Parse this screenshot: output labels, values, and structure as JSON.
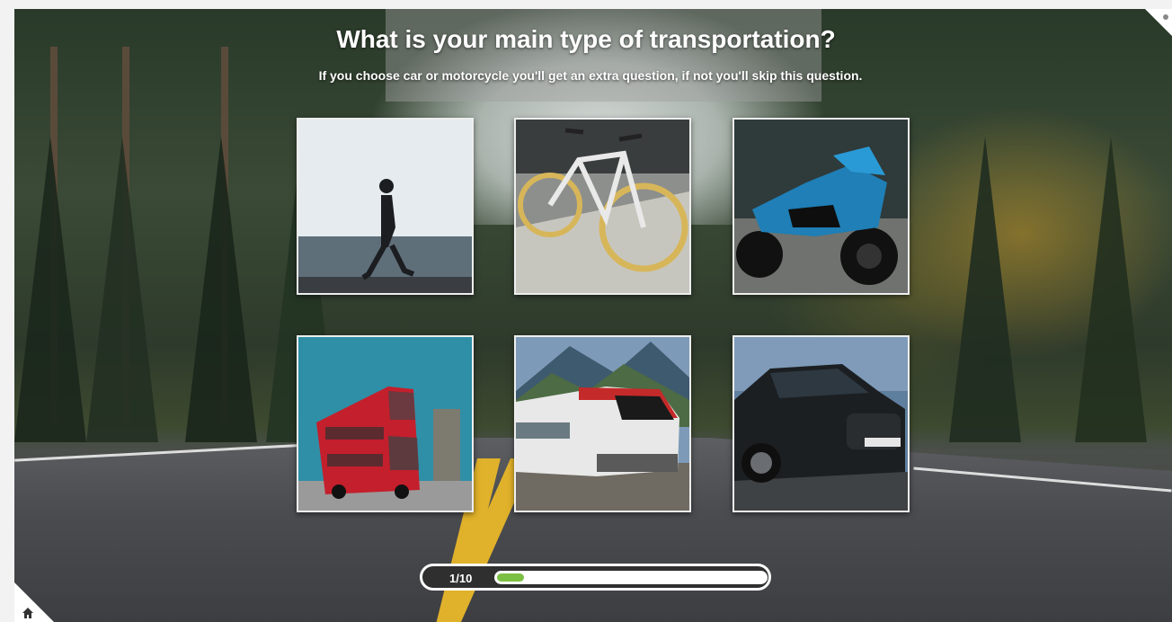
{
  "question": {
    "title": "What is your main type of transportation?",
    "subtitle": "If you choose car or motorcycle you'll get an extra question, if not you'll skip this question."
  },
  "options": [
    {
      "id": "walking",
      "icon": "person-walking-icon"
    },
    {
      "id": "bicycle",
      "icon": "bicycle-icon"
    },
    {
      "id": "motorcycle",
      "icon": "motorcycle-icon"
    },
    {
      "id": "bus",
      "icon": "double-decker-bus-icon"
    },
    {
      "id": "train",
      "icon": "train-icon"
    },
    {
      "id": "car",
      "icon": "car-icon"
    }
  ],
  "progress": {
    "label": "1/10",
    "current": 1,
    "total": 10,
    "fraction": 0.1,
    "color": "#7cc043"
  },
  "nav": {
    "home_icon": "home-icon"
  }
}
